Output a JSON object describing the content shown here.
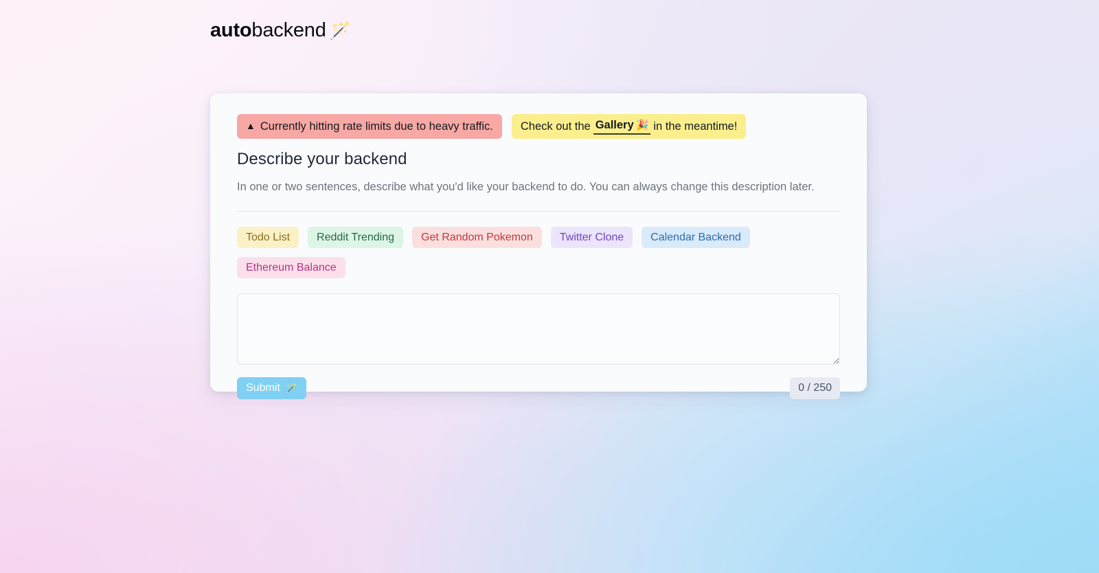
{
  "logo": {
    "strong": "auto",
    "light": "backend",
    "wand_icon": "🪄"
  },
  "banners": {
    "alert": {
      "icon": "▲",
      "text": "Currently hitting rate limits due to heavy traffic.",
      "bg_color": "#f7a8a5"
    },
    "info": {
      "prefix": "Check out the",
      "link_label": "Gallery",
      "link_icon": "🎉",
      "suffix": "in the meantime!",
      "bg_color": "#fbef8d"
    }
  },
  "main": {
    "title": "Describe your backend",
    "subtitle": "In one or two sentences, describe what you'd like your backend to do. You can always change this description later."
  },
  "chips": [
    {
      "label": "Todo List",
      "bg": "#fbf1c7",
      "fg": "#8a6d1f"
    },
    {
      "label": "Reddit Trending",
      "bg": "#dcf5e4",
      "fg": "#276749"
    },
    {
      "label": "Get Random Pokemon",
      "bg": "#fbdfdf",
      "fg": "#c2383f"
    },
    {
      "label": "Twitter Clone",
      "bg": "#ece4fb",
      "fg": "#6b46c1"
    },
    {
      "label": "Calendar Backend",
      "bg": "#d9eafb",
      "fg": "#2b6cb0"
    },
    {
      "label": "Ethereum Balance",
      "bg": "#fbe0ec",
      "fg": "#b83280"
    }
  ],
  "prompt": {
    "value": "",
    "placeholder": ""
  },
  "footer": {
    "submit_label": "Submit",
    "submit_icon": "🪄",
    "counter": "0 / 250"
  }
}
